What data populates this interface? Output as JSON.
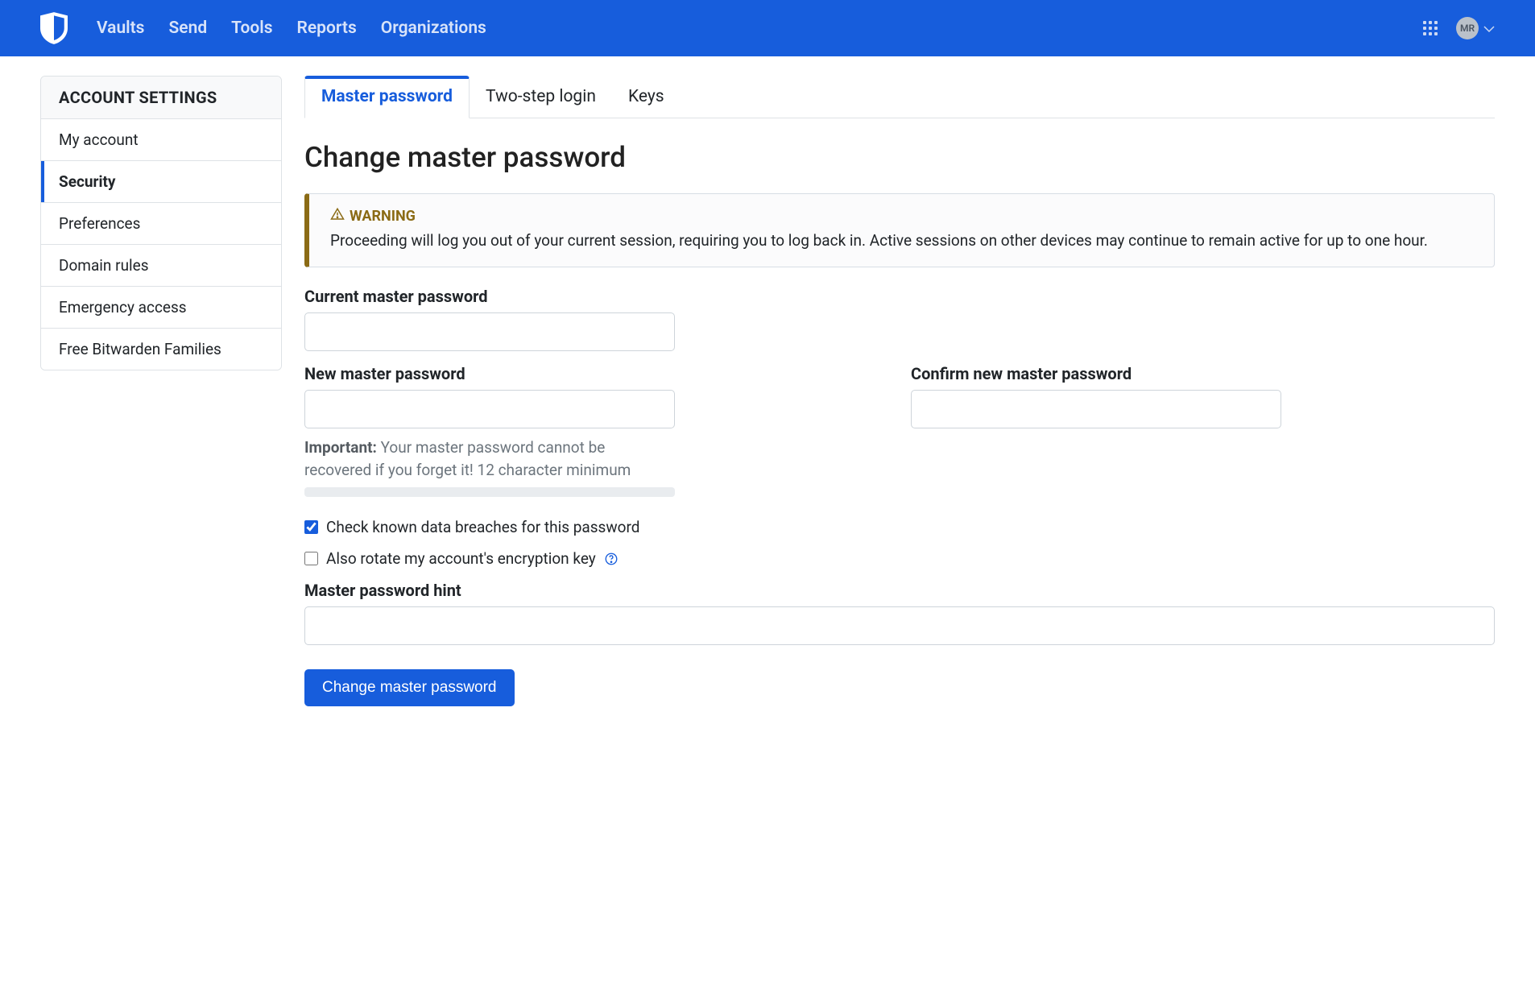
{
  "nav": {
    "items": [
      "Vaults",
      "Send",
      "Tools",
      "Reports",
      "Organizations"
    ],
    "avatarInitials": "MR"
  },
  "sidebar": {
    "header": "ACCOUNT SETTINGS",
    "items": [
      {
        "label": "My account",
        "active": false
      },
      {
        "label": "Security",
        "active": true
      },
      {
        "label": "Preferences",
        "active": false
      },
      {
        "label": "Domain rules",
        "active": false
      },
      {
        "label": "Emergency access",
        "active": false
      },
      {
        "label": "Free Bitwarden Families",
        "active": false
      }
    ]
  },
  "tabs": [
    {
      "label": "Master password",
      "active": true
    },
    {
      "label": "Two-step login",
      "active": false
    },
    {
      "label": "Keys",
      "active": false
    }
  ],
  "page": {
    "title": "Change master password",
    "warning": {
      "title": "WARNING",
      "body": "Proceeding will log you out of your current session, requiring you to log back in. Active sessions on other devices may continue to remain active for up to one hour."
    },
    "form": {
      "currentLabel": "Current master password",
      "newLabel": "New master password",
      "confirmLabel": "Confirm new master password",
      "hintImportantLabel": "Important:",
      "hintImportantText": " Your master password cannot be recovered if you forget it! 12 character minimum",
      "checkBreaches": {
        "label": "Check known data breaches for this password",
        "checked": true
      },
      "rotateKey": {
        "label": "Also rotate my account's encryption key",
        "checked": false
      },
      "hintFieldLabel": "Master password hint",
      "submitLabel": "Change master password"
    }
  }
}
